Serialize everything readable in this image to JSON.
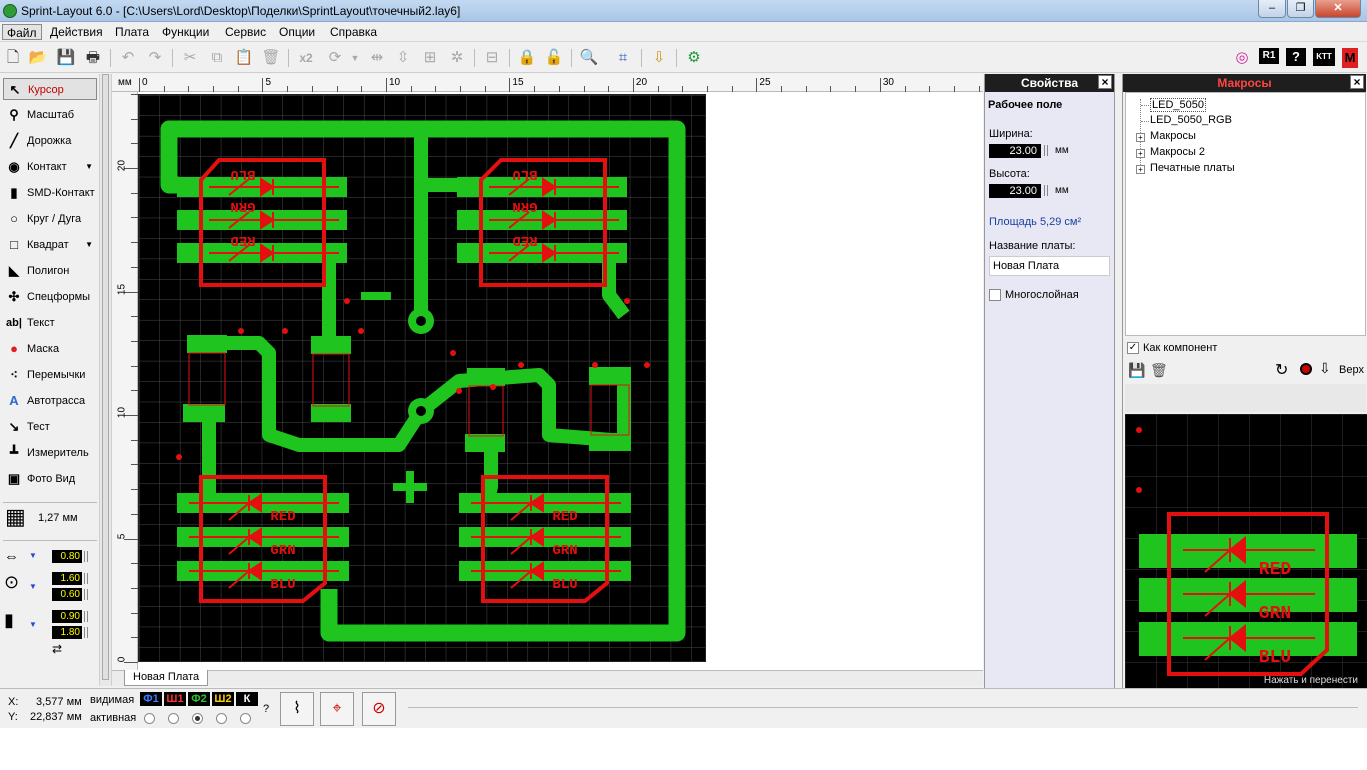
{
  "window": {
    "title": "Sprint-Layout 6.0 - [C:\\Users\\Lord\\Desktop\\Поделки\\SprintLayout\\точечный2.lay6]",
    "controls": [
      "‒",
      "❐",
      "✕"
    ]
  },
  "menu": [
    "Файл",
    "Действия",
    "Плата",
    "Функции",
    "Сервис",
    "Опции",
    "Справка"
  ],
  "toolbar": {
    "icons": [
      "new-file-icon",
      "open-folder-icon",
      "save-icon",
      "print-icon",
      "undo-icon",
      "redo-icon",
      "cut-icon",
      "copy-icon",
      "paste-icon",
      "delete-icon",
      "duplicate-icon",
      "rotate-icon",
      "mirror-horizontal-icon",
      "mirror-vertical-icon",
      "align-icon",
      "group-icon",
      "ungroup-icon",
      "lock-icon",
      "unlock-icon",
      "zoom-icon",
      "crop-icon",
      "import-icon",
      "settings-gear-icon"
    ],
    "mult_label": "x2",
    "right_icons": [
      "cd-icon",
      "r1-icon",
      "help-icon",
      "ktt-icon",
      "m-icon"
    ],
    "r1": "R1",
    "ktt": "KTT",
    "m": "M"
  },
  "tools": [
    {
      "label": "Курсор",
      "icon": "cursor-icon",
      "glyph": "↖",
      "selected": true
    },
    {
      "label": "Масштаб",
      "icon": "zoom-tool-icon",
      "glyph": "⚲"
    },
    {
      "label": "Дорожка",
      "icon": "track-icon",
      "glyph": "╱"
    },
    {
      "label": "Контакт",
      "icon": "pad-icon",
      "glyph": "◉",
      "dropdown": true
    },
    {
      "label": "SMD-Контакт",
      "icon": "smd-pad-icon",
      "glyph": "▮"
    },
    {
      "label": "Круг / Дуга",
      "icon": "circle-arc-icon",
      "glyph": "○"
    },
    {
      "label": "Квадрат",
      "icon": "square-icon",
      "glyph": "□",
      "dropdown": true
    },
    {
      "label": "Полигон",
      "icon": "polygon-icon",
      "glyph": "◣"
    },
    {
      "label": "Спецформы",
      "icon": "special-forms-icon",
      "glyph": "✣"
    },
    {
      "label": "Текст",
      "icon": "text-tool-icon",
      "glyph": "ab|"
    },
    {
      "label": "Маска",
      "icon": "mask-icon",
      "glyph": "●"
    },
    {
      "label": "Перемычки",
      "icon": "jumper-icon",
      "glyph": "⁖"
    },
    {
      "label": "Автотрасса",
      "icon": "autoroute-icon",
      "glyph": "A"
    },
    {
      "label": "Тест",
      "icon": "test-icon",
      "glyph": "↘"
    },
    {
      "label": "Измеритель",
      "icon": "measure-icon",
      "glyph": "┻"
    },
    {
      "label": "Фото Вид",
      "icon": "photo-view-icon",
      "glyph": "▣"
    }
  ],
  "grid": {
    "label": "1,27 мм",
    "icon": "grid-icon"
  },
  "track_width": "0.80",
  "pad_outer": "1.60",
  "pad_inner": "0.60",
  "smd_w": "0.90",
  "smd_h": "1.80",
  "ruler": {
    "unit": "мм",
    "h_ticks": [
      "0",
      "5",
      "10",
      "15",
      "20",
      "25",
      "30"
    ],
    "v_ticks": [
      "20",
      "15",
      "10",
      "5",
      "0"
    ]
  },
  "board_tab": "Новая Плата",
  "board": {
    "labels": {
      "blu": "BLU",
      "grn": "GRN",
      "red": "RED",
      "minus": "−",
      "plus": "+"
    }
  },
  "properties": {
    "header": "Свойства",
    "section": "Рабочее поле",
    "width_label": "Ширина:",
    "width_value": "23.00",
    "height_label": "Высота:",
    "height_value": "23.00",
    "unit": "мм",
    "area": "Площадь   5,29 см²",
    "name_label": "Название платы:",
    "name_value": "Новая Плата",
    "multilayer": "Многослойная"
  },
  "macros": {
    "header": "Макросы",
    "tree": [
      {
        "label": "LED_5050",
        "selected": true
      },
      {
        "label": "LED_5050_RGB"
      },
      {
        "label": "Макросы",
        "expandable": true
      },
      {
        "label": "Макросы 2",
        "expandable": true
      },
      {
        "label": "Печатные платы",
        "expandable": true
      }
    ],
    "as_component": "Как компонент",
    "top_label": "Верх",
    "hint": "Нажать и перенести"
  },
  "status": {
    "x_label": "X:",
    "x_value": "3,577 мм",
    "y_label": "Y:",
    "y_value": "22,837 мм",
    "visible": "видимая",
    "active": "активная",
    "layers": [
      {
        "name": "Ф1",
        "color": "#3a7cff"
      },
      {
        "name": "Ш1",
        "color": "#ff3030"
      },
      {
        "name": "Ф2",
        "color": "#30c030"
      },
      {
        "name": "Ш2",
        "color": "#ffd000"
      },
      {
        "name": "К",
        "color": "#ffffff"
      }
    ],
    "question": "?"
  },
  "colors": {
    "copper": "#1fc41f",
    "silk": "#e41010",
    "board": "#000000"
  }
}
